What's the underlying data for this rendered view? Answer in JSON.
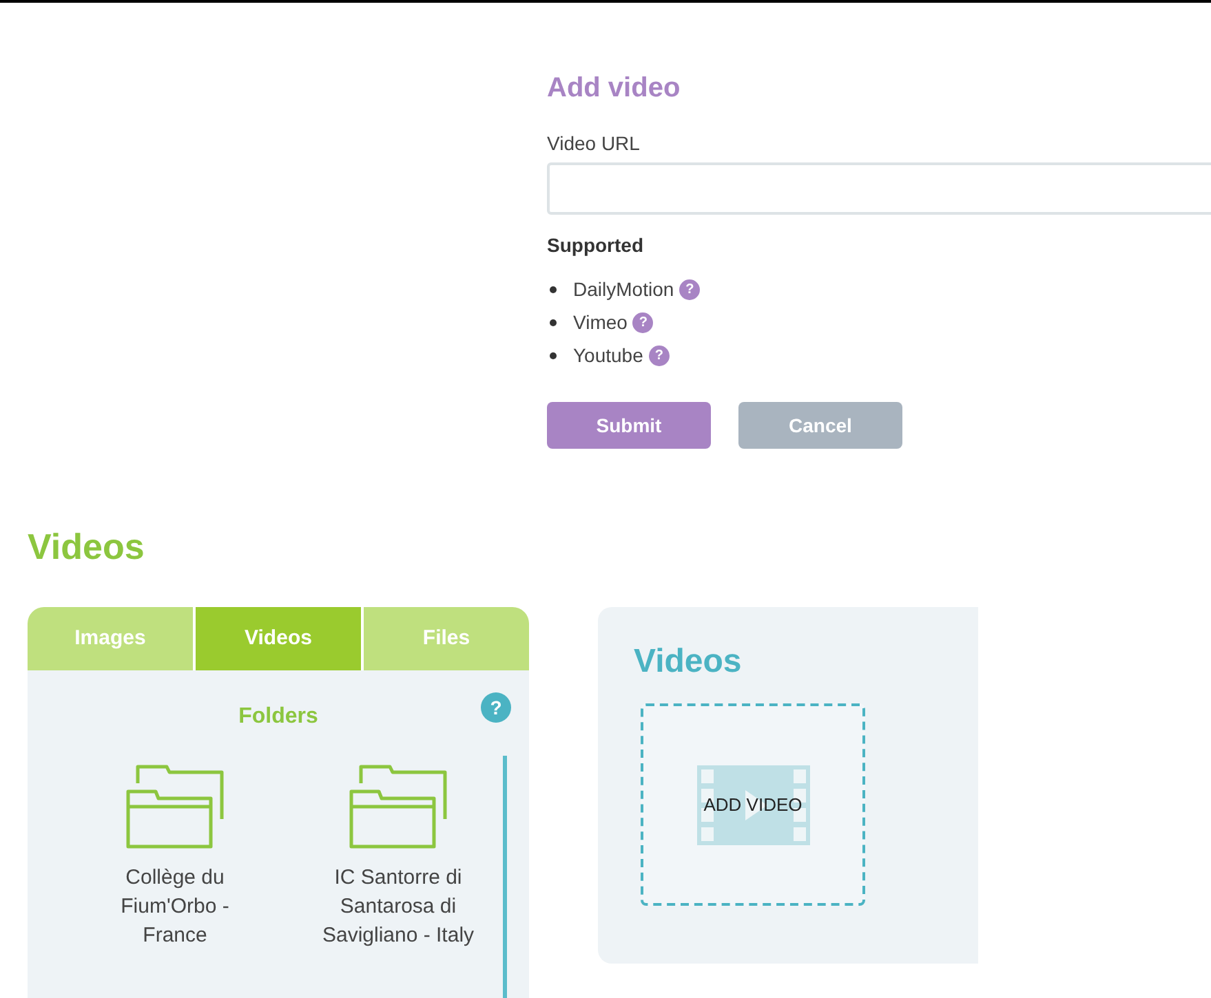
{
  "form": {
    "title": "Add video",
    "url_label": "Video URL",
    "supported_heading": "Supported",
    "providers": [
      {
        "name": "DailyMotion",
        "help": "?"
      },
      {
        "name": "Vimeo",
        "help": "?"
      },
      {
        "name": "Youtube",
        "help": "?"
      }
    ],
    "buttons": [
      {
        "label": "Submit",
        "kind": "primary"
      },
      {
        "label": "Cancel",
        "kind": "secondary"
      }
    ]
  },
  "section_title": "Videos",
  "tabs": [
    {
      "label": "Images",
      "selected": false
    },
    {
      "label": "Videos",
      "selected": true
    },
    {
      "label": "Files",
      "selected": false
    }
  ],
  "folders_panel": {
    "title": "Folders",
    "help": "?",
    "folders": [
      {
        "name": "Collège du Fium'Orbo - France"
      },
      {
        "name": "IC Santorre di Santarosa di Savigliano - Italy"
      }
    ]
  },
  "videos_card": {
    "title": "Videos",
    "add_label": "ADD VIDEO"
  }
}
